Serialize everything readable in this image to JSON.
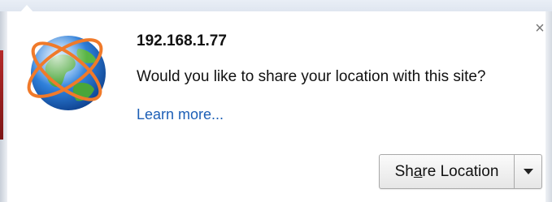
{
  "infobar": {
    "host": "192.168.1.77",
    "question": "Would you like to share your location with this site?",
    "learn_more": "Learn more...",
    "close_glyph": "×",
    "share_button": {
      "label_prefix": "Sh",
      "label_underlined": "a",
      "label_suffix": "re Location"
    },
    "globe_icon": "location-globe-icon",
    "dropdown_icon": "chevron-down-icon"
  },
  "colors": {
    "link": "#1d5fb6",
    "orbit": "#f07a2a",
    "ocean": "#2d7ed8",
    "land": "#4aa63a"
  }
}
